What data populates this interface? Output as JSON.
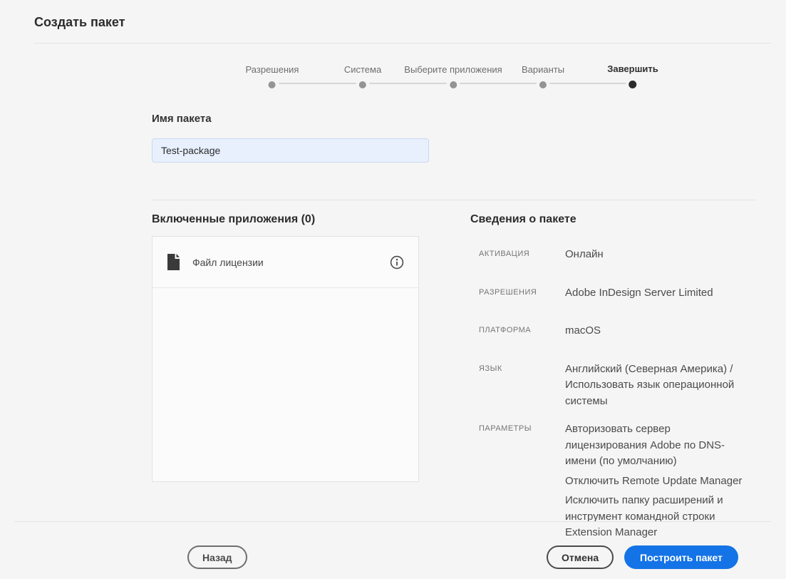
{
  "page": {
    "title": "Создать пакет"
  },
  "stepper": {
    "steps": [
      {
        "label": "Разрешения",
        "state": "done"
      },
      {
        "label": "Система",
        "state": "done"
      },
      {
        "label": "Выберите приложения",
        "state": "done"
      },
      {
        "label": "Варианты",
        "state": "done"
      },
      {
        "label": "Завершить",
        "state": "current"
      }
    ]
  },
  "form": {
    "package_name_label": "Имя пакета",
    "package_name_value": "Test-package"
  },
  "included_apps": {
    "title": "Включенные приложения (0)",
    "items": [
      {
        "label": "Файл лицензии",
        "icon": "file-icon",
        "trailing_icon": "info-icon"
      }
    ]
  },
  "package_details": {
    "title": "Сведения о пакете",
    "rows": [
      {
        "label": "АКТИВАЦИЯ",
        "value": "Онлайн"
      },
      {
        "label": "РАЗРЕШЕНИЯ",
        "value": "Adobe InDesign Server Limited"
      },
      {
        "label": "ПЛАТФОРМА",
        "value": "macOS"
      },
      {
        "label": "ЯЗЫК",
        "value": "Английский (Северная Америка) / Использовать язык операционной системы"
      },
      {
        "label": "ПАРАМЕТРЫ",
        "values": [
          "Авторизовать сервер лицензирования Adobe по DNS-имени (по умолчанию)",
          "Отключить Remote Update Manager",
          "Исключить папку расширений и инструмент командной строки Extension Manager"
        ]
      }
    ]
  },
  "footer": {
    "back_label": "Назад",
    "cancel_label": "Отмена",
    "build_label": "Построить пакет"
  },
  "colors": {
    "accent_blue": "#1473e6",
    "input_autofill_bg": "#e8f0fe",
    "page_bg": "#f5f5f5"
  }
}
